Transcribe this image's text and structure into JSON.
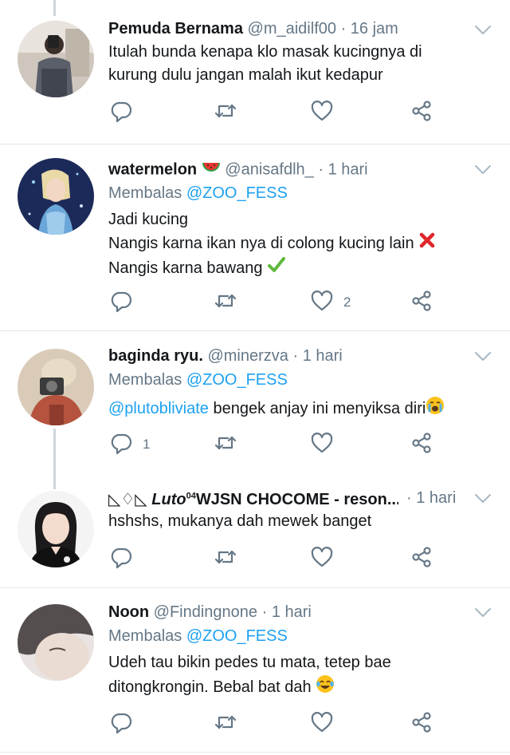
{
  "tweets": [
    {
      "name": "Pemuda Bernama",
      "handle": "@m_aidilf00",
      "sep": "·",
      "time": "16 jam",
      "lines": [
        "Itulah bunda kenapa klo masak kucingnya di",
        "kurung dulu jangan malah ikut kedapur"
      ],
      "counts": {
        "reply": "",
        "retweet": "",
        "like": ""
      }
    },
    {
      "name": "watermelon",
      "handle": "@anisafdlh_",
      "sep": "·",
      "time": "1 hari",
      "reply_prefix": "Membalas",
      "reply_handle": "@ZOO_FESS",
      "lines": [
        "Jadi kucing",
        "Nangis karna ikan nya di colong kucing lain",
        "Nangis karna bawang"
      ],
      "counts": {
        "reply": "",
        "retweet": "",
        "like": "2"
      }
    },
    {
      "name": "baginda ryu.",
      "handle": "@minerzva",
      "sep": "·",
      "time": "1 hari",
      "reply_prefix": "Membalas",
      "reply_handle": "@ZOO_FESS",
      "mention": "@plutobliviate",
      "text": "bengek anjay ini menyiksa diri",
      "counts": {
        "reply": "1",
        "retweet": "",
        "like": ""
      }
    },
    {
      "name_prefix": "◺♢◺",
      "name_italic": "Luto",
      "name_sup": "04",
      "name_rest": "WJSN CHOCOME - reson...",
      "sep": "·",
      "time": "1 hari",
      "lines": [
        "hshshs, mukanya dah mewek banget"
      ],
      "counts": {
        "reply": "",
        "retweet": "",
        "like": ""
      }
    },
    {
      "name": "Noon",
      "handle": "@Findingnone",
      "sep": "·",
      "time": "1 hari",
      "reply_prefix": "Membalas",
      "reply_handle": "@ZOO_FESS",
      "lines": [
        "Udeh tau bikin pedes tu mata, tetep bae",
        "ditongkrongin. Bebal bat dah"
      ],
      "counts": {
        "reply": "",
        "retweet": "",
        "like": ""
      }
    }
  ],
  "icons": {
    "reply": "reply-icon",
    "retweet": "retweet-icon",
    "like": "heart-icon",
    "share": "share-icon",
    "menu": "chevron-down-icon"
  },
  "colors": {
    "text": "#14171a",
    "secondary": "#657786",
    "link": "#1da1f2",
    "divider": "#e1e8ed",
    "thread_line": "#ccd6dd"
  }
}
